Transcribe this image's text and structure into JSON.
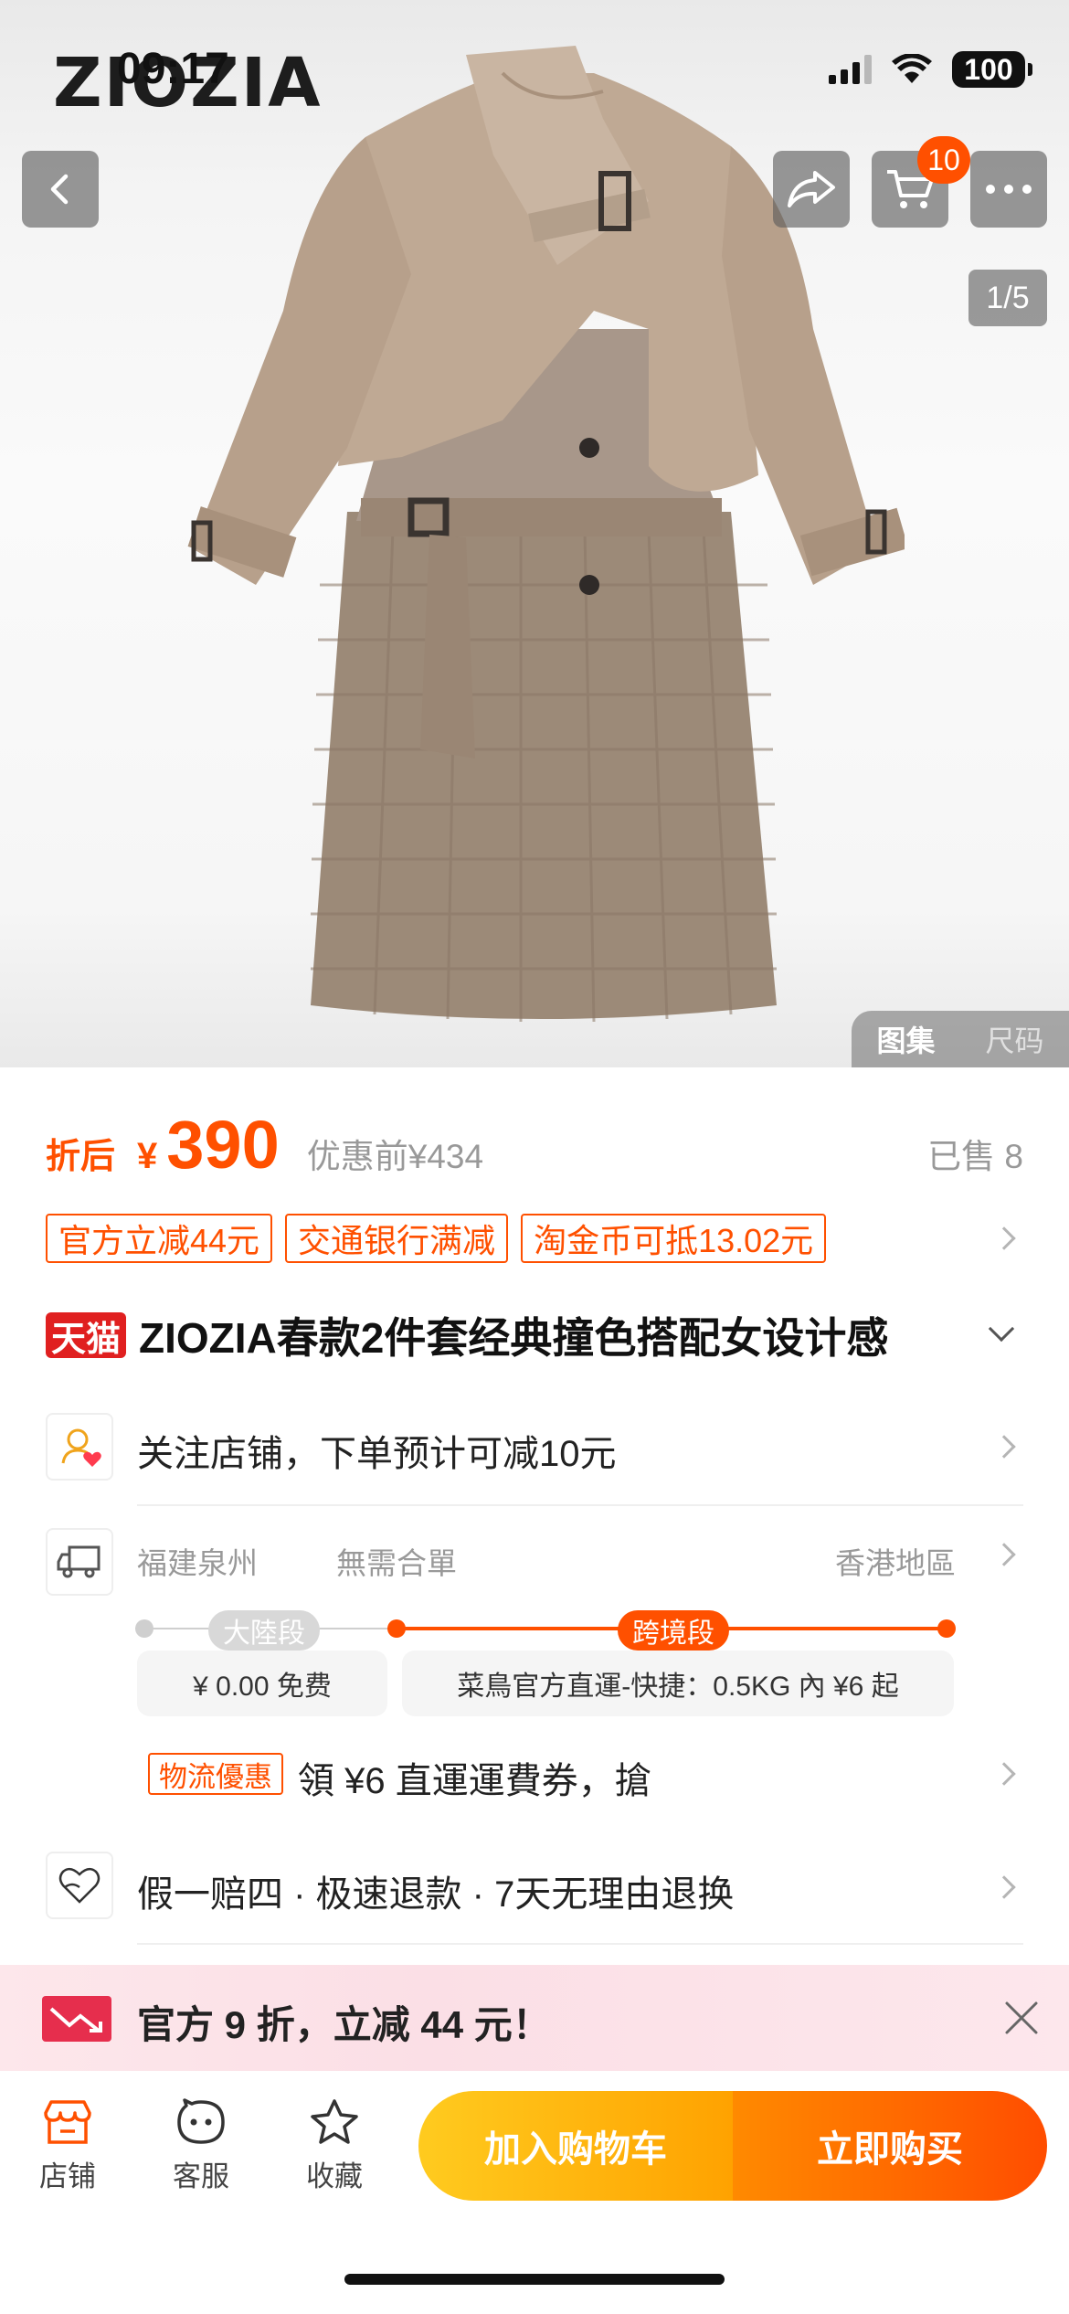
{
  "status_bar": {
    "time": "09:17",
    "battery": "100"
  },
  "hero": {
    "brand_logo": "ZIOZIA",
    "cart_count": "10",
    "page_indicator": "1/5",
    "gallery_tabs": [
      "图集",
      "尺码"
    ]
  },
  "price": {
    "prefix": "折后",
    "currency": "¥",
    "value": "390",
    "original": "优惠前¥434",
    "sold": "已售 8"
  },
  "promo_tags": [
    "官方立减44元",
    "交通银行满减",
    "淘金币可抵13.02元"
  ],
  "title": {
    "badge": "天猫",
    "text": "ZIOZIA春款2件套经典撞色搭配女设计感"
  },
  "follow_store": {
    "text": "关注店铺，下单预计可减10元"
  },
  "shipping": {
    "from": "福建泉州",
    "merge": "無需合單",
    "to": "香港地區",
    "segment1": "大陸段",
    "segment2": "跨境段",
    "fee1": "¥ 0.00 免费",
    "fee2": "菜鳥官方直運-快捷：0.5KG 內 ¥6 起",
    "logistics_tag": "物流優惠",
    "logistics_text": "領 ¥6 直運運費券，搶"
  },
  "guarantee": {
    "text": "假一赔四 · 极速退款 · 7天无理由退换"
  },
  "promo_banner": {
    "text": "官方 9 折，立减 44 元！"
  },
  "bottom_bar": {
    "store": "店铺",
    "service": "客服",
    "favorite": "收藏",
    "add_to_cart": "加入购物车",
    "buy_now": "立即购买"
  },
  "colors": {
    "accent": "#ff5000",
    "tmall_red": "#e02020",
    "cta_yellow": "#ffb300"
  }
}
